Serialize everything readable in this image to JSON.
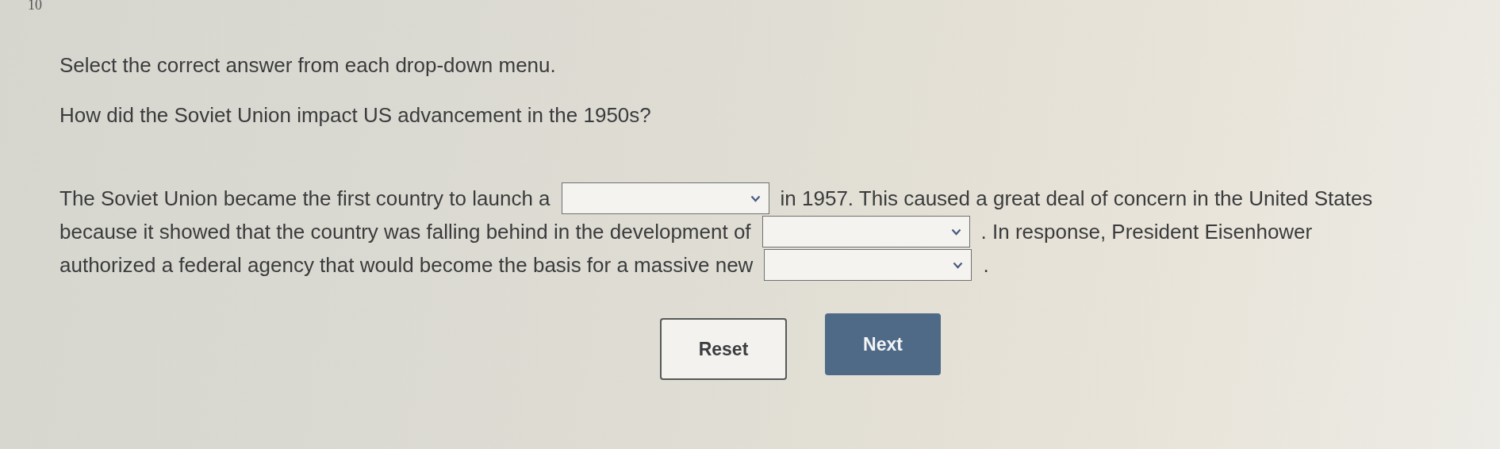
{
  "question_number": "10",
  "instruction": "Select the correct answer from each drop-down menu.",
  "question": "How did the Soviet Union impact US advancement in the 1950s?",
  "passage_lines": [
    [
      {
        "kind": "text",
        "text": "The Soviet Union became the first country to launch a"
      },
      {
        "kind": "dropdown"
      },
      {
        "kind": "text",
        "text": "in 1957. This caused a great deal of concern in the United States"
      }
    ],
    [
      {
        "kind": "text",
        "text": "because it showed that the country was falling behind in the development of"
      },
      {
        "kind": "dropdown"
      },
      {
        "kind": "text",
        "text": ". In response, President Eisenhower"
      }
    ],
    [
      {
        "kind": "text",
        "text": "authorized a federal agency that would become the basis for a massive new"
      },
      {
        "kind": "dropdown"
      },
      {
        "kind": "text",
        "text": "."
      }
    ]
  ],
  "buttons": [
    {
      "label": "Reset",
      "kind": "secondary"
    },
    {
      "label": "Next",
      "kind": "primary"
    }
  ]
}
